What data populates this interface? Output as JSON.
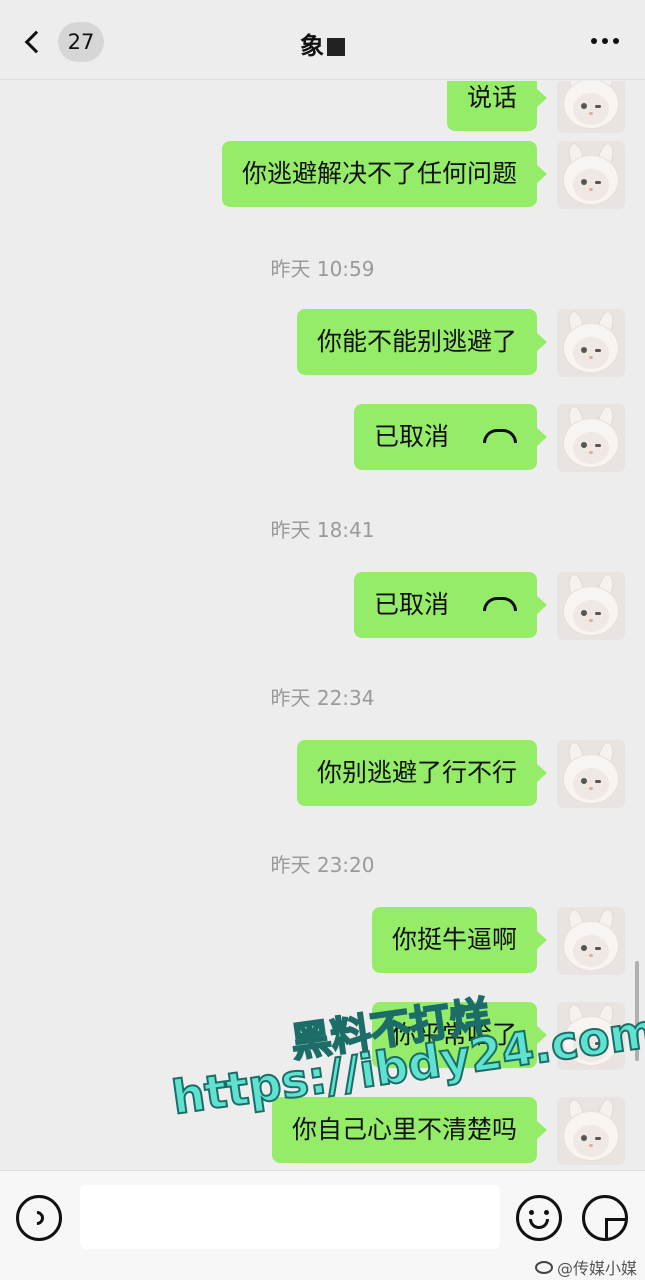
{
  "header": {
    "unread_count": "27",
    "contact_name": "象"
  },
  "messages": [
    {
      "text": "说话"
    },
    {
      "text": "你逃避解决不了任何问题"
    },
    {
      "time": "昨天 10:59"
    },
    {
      "text": "你能不能别逃避了"
    },
    {
      "text": "已取消",
      "icon": "phone-hangup-icon"
    },
    {
      "time": "昨天 18:41"
    },
    {
      "text": "已取消",
      "icon": "phone-hangup-icon"
    },
    {
      "time": "昨天 22:34"
    },
    {
      "text": "你别逃避了行不行"
    },
    {
      "time": "昨天 23:20"
    },
    {
      "text": "你挺牛逼啊"
    },
    {
      "text": "你平常哈了"
    },
    {
      "text": "你自己心里不清楚吗"
    }
  ],
  "watermark": {
    "line1": "黑料不打烊",
    "line2": "https://ibdy24.com"
  },
  "footer": {
    "attribution": "@传媒小媒"
  },
  "colors": {
    "bubble": "#95ec69",
    "background": "#ededed",
    "watermark": "#5fe2d0"
  }
}
